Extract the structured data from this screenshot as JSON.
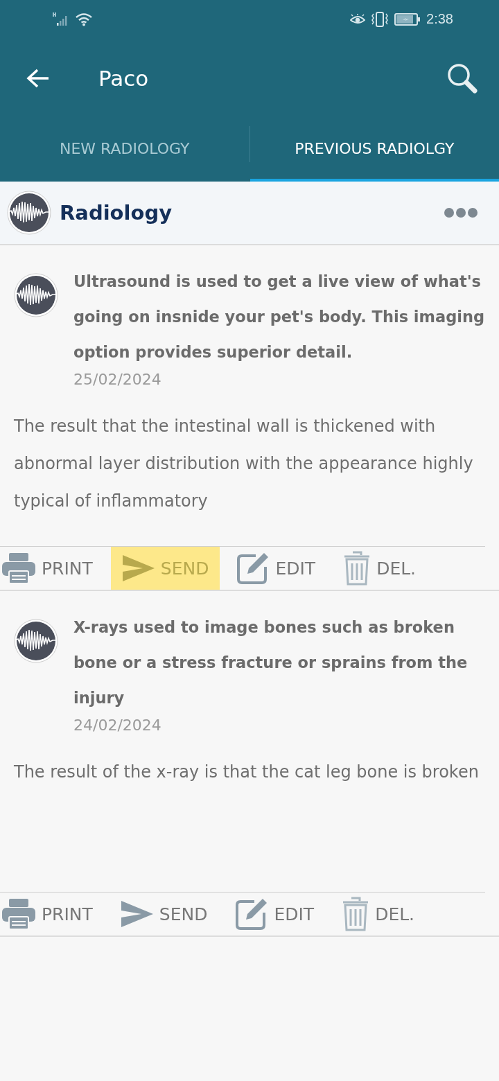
{
  "status_bar": {
    "time": "2:38"
  },
  "app_bar": {
    "title": "Paco"
  },
  "tabs": [
    {
      "label": "NEW RADIOLOGY",
      "selected": false
    },
    {
      "label": "PREVIOUS RADIOLGY",
      "selected": true
    }
  ],
  "section": {
    "title": "Radiology"
  },
  "records": [
    {
      "title": "Ultrasound is used to get a live view of what's going on insnide your pet's body. This imaging option provides superior detail.",
      "date": "25/02/2024",
      "result": "The result that the intestinal wall is thickened with abnormal layer distribution with the appearance highly typical of inflammatory",
      "actions": [
        {
          "kind": "print",
          "label": "PRINT",
          "highlighted": false
        },
        {
          "kind": "send",
          "label": "SEND",
          "highlighted": true
        },
        {
          "kind": "edit",
          "label": "EDIT",
          "highlighted": false
        },
        {
          "kind": "delete",
          "label": "DEL.",
          "highlighted": false
        }
      ]
    },
    {
      "title": "X-rays used to image bones such as broken bone or a stress fracture or sprains from the injury",
      "date": "24/02/2024",
      "result": "The result of the x-ray is that the cat leg bone is broken",
      "actions": [
        {
          "kind": "print",
          "label": "PRINT",
          "highlighted": false
        },
        {
          "kind": "send",
          "label": "SEND",
          "highlighted": false
        },
        {
          "kind": "edit",
          "label": "EDIT",
          "highlighted": false
        },
        {
          "kind": "delete",
          "label": "DEL.",
          "highlighted": false
        }
      ]
    }
  ]
}
